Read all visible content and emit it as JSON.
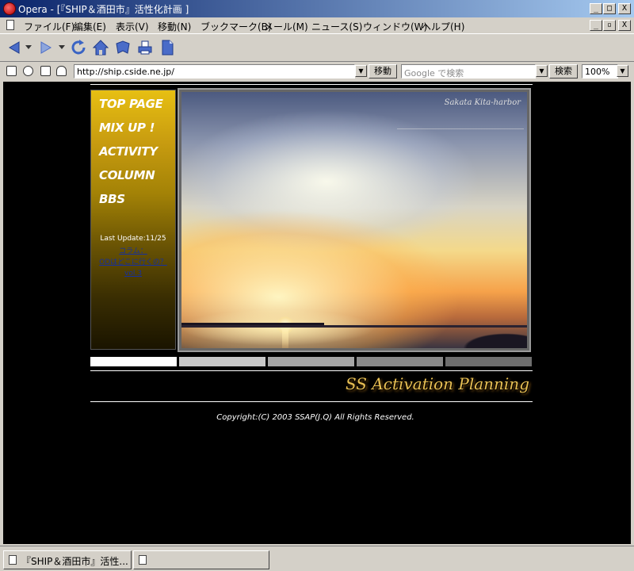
{
  "window": {
    "title": "Opera - [『SHIP＆酒田市』活性化計画 ]",
    "controls": [
      "_",
      "□",
      "X"
    ],
    "mdi_controls": [
      "_",
      "▫",
      "X"
    ]
  },
  "menu": {
    "items": [
      "ファイル(F)",
      "編集(E)",
      "表示(V)",
      "移動(N)",
      "ブックマーク(B)",
      "メール(M)",
      "ニュース(S)",
      "ウィンドウ(W)",
      "ヘルプ(H)"
    ]
  },
  "toolbar": {
    "icons": [
      "back-arrow-icon",
      "forward-arrow-icon",
      "reload-icon",
      "home-icon",
      "hotlist-icon",
      "print-icon",
      "document-icon"
    ]
  },
  "address": {
    "url": "http://ship.cside.ne.jp/",
    "go_label": "移動",
    "search_placeholder": "Google で検索",
    "search_label": "検索",
    "zoom": "100%"
  },
  "page": {
    "nav": [
      "TOP PAGE",
      "MIX UP !",
      "ACTIVITY",
      "COLUMN",
      "BBS"
    ],
    "last_update": "Last Update:11/25",
    "update_links": [
      "コラム：",
      "ODはどこに行くの？",
      "vol.3"
    ],
    "photo_caption": "Sakata Kita-harbor",
    "swatch_colors": [
      "#ffffff",
      "#c8c8c8",
      "#a5a5a5",
      "#8a8a8a",
      "#6e6e6e"
    ],
    "brand": "SS Activation Planning",
    "copyright": "Copyright:(C) 2003 SSAP(J.Q) All Rights Reserved."
  },
  "statusbar": {
    "tabs": [
      "『SHIP＆酒田市』活性...",
      ""
    ]
  },
  "colors": {
    "titlebar_start": "#0a246a",
    "titlebar_end": "#a6caf0",
    "nav_gold": "#e7bf12",
    "brand_gold": "#e8c054",
    "link": "#1530a0"
  }
}
